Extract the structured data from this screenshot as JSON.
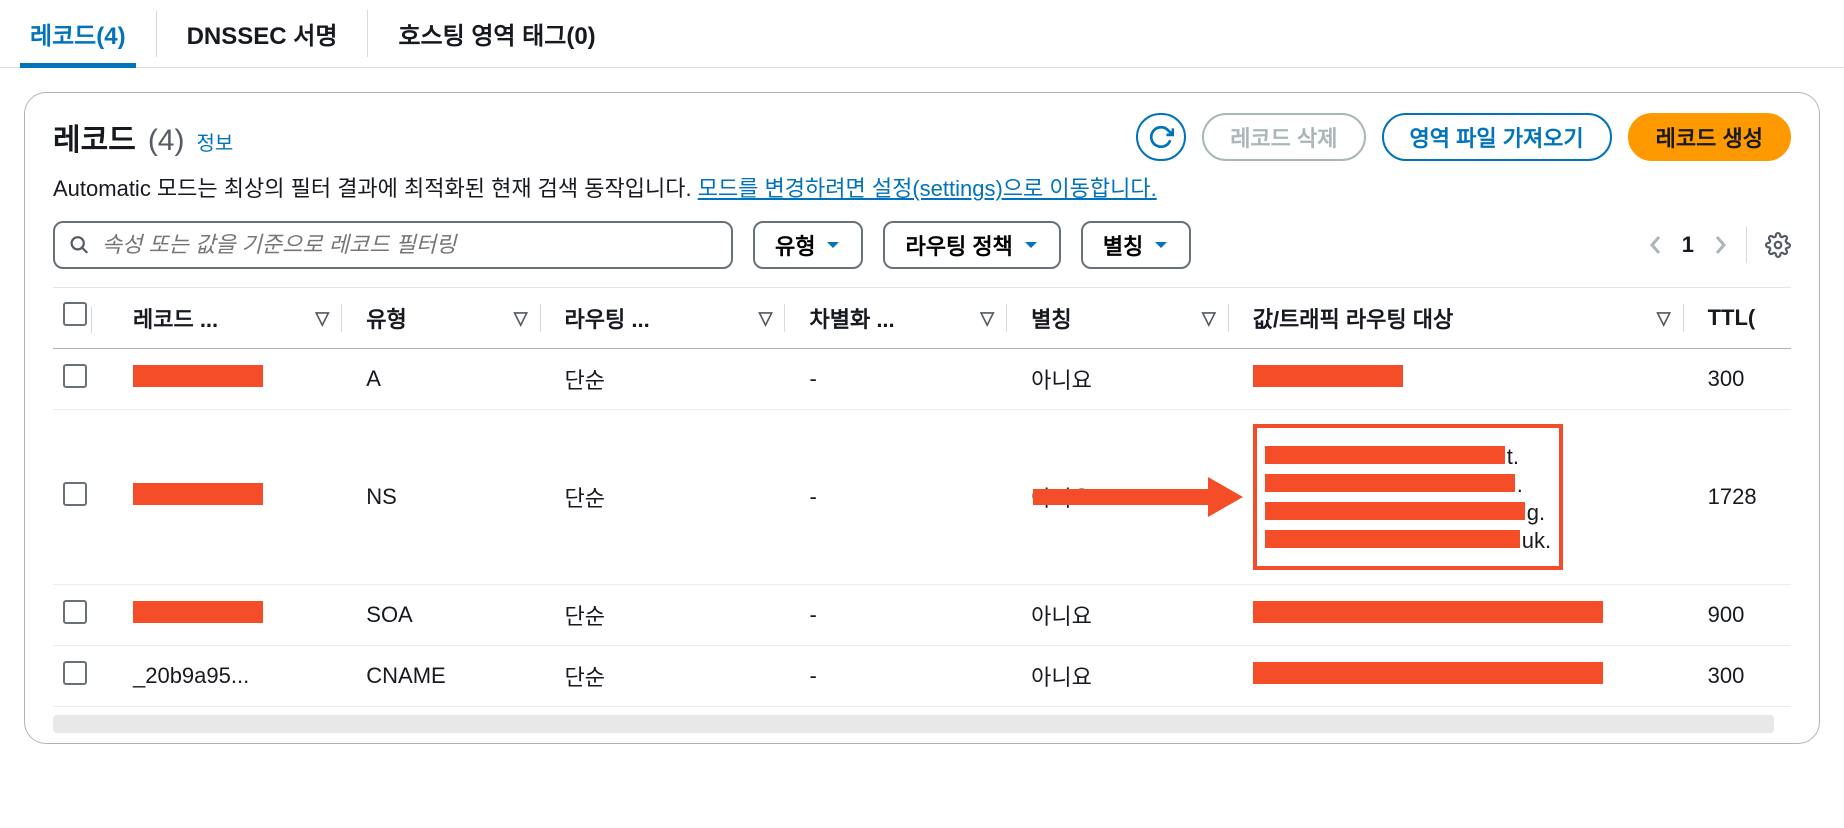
{
  "tabs": {
    "records": "레코드(4)",
    "dnssec": "DNSSEC 서명",
    "tags": "호스팅 영역 태그(0)"
  },
  "panel": {
    "title": "레코드",
    "count": "(4)",
    "info": "정보",
    "refresh_aria": "새로 고침",
    "delete_btn": "레코드 삭제",
    "import_btn": "영역 파일 가져오기",
    "create_btn": "레코드 생성",
    "mode_text": "Automatic 모드는 최상의 필터 결과에 최적화된 현재 검색 동작입니다. ",
    "mode_link": "모드를 변경하려면 설정(settings)으로 이동합니다."
  },
  "filters": {
    "search_placeholder": "속성 또는 값을 기준으로 레코드 필터링",
    "type": "유형",
    "routing": "라우팅 정책",
    "alias": "별칭",
    "page": "1"
  },
  "columns": {
    "name": "레코드 ...",
    "type": "유형",
    "routing": "라우팅 ...",
    "diff": "차별화 ...",
    "alias": "별칭",
    "value": "값/트래픽 라우팅 대상",
    "ttl": "TTL("
  },
  "rows": [
    {
      "name_redacted": true,
      "type": "A",
      "routing": "단순",
      "diff": "-",
      "alias": "아니요",
      "value_redacted": "single",
      "ttl": "300"
    },
    {
      "name_redacted": true,
      "type": "NS",
      "routing": "단순",
      "diff": "-",
      "alias": "아니요",
      "value_redacted": "ns",
      "ttl": "1728"
    },
    {
      "name_redacted": true,
      "type": "SOA",
      "routing": "단순",
      "diff": "-",
      "alias": "아니요",
      "value_redacted": "full",
      "ttl": "900"
    },
    {
      "name": "_20b9a95...",
      "type": "CNAME",
      "routing": "단순",
      "diff": "-",
      "alias": "아니요",
      "value_redacted": "full",
      "ttl": "300"
    }
  ],
  "ns_suffixes": [
    "t.",
    ".",
    "g.",
    "uk."
  ]
}
